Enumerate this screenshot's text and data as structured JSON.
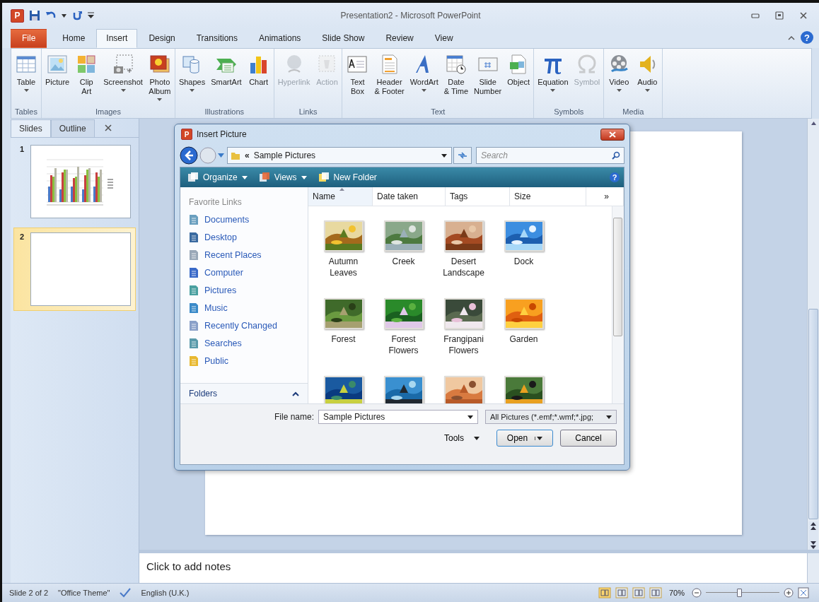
{
  "window": {
    "app_icon": "P",
    "title": "Presentation2 - Microsoft PowerPoint",
    "help": "?"
  },
  "tabs": [
    {
      "label": "File",
      "kind": "backstage",
      "selected": false
    },
    {
      "label": "Home",
      "kind": "tab",
      "selected": false
    },
    {
      "label": "Insert",
      "kind": "tab",
      "selected": true
    },
    {
      "label": "Design",
      "kind": "tab",
      "selected": false
    },
    {
      "label": "Transitions",
      "kind": "tab",
      "selected": false
    },
    {
      "label": "Animations",
      "kind": "tab",
      "selected": false
    },
    {
      "label": "Slide Show",
      "kind": "tab",
      "selected": false
    },
    {
      "label": "Review",
      "kind": "tab",
      "selected": false
    },
    {
      "label": "View",
      "kind": "tab",
      "selected": false
    }
  ],
  "ribbon": [
    {
      "label": "Tables",
      "buttons": [
        {
          "label": "Table",
          "dropdown": true,
          "disabled": false
        }
      ]
    },
    {
      "label": "Images",
      "buttons": [
        {
          "label": "Picture",
          "dropdown": false,
          "disabled": false
        },
        {
          "label": "Clip\nArt",
          "dropdown": false,
          "disabled": false
        },
        {
          "label": "Screenshot",
          "dropdown": true,
          "disabled": false
        },
        {
          "label": "Photo\nAlbum",
          "dropdown": true,
          "disabled": false
        }
      ]
    },
    {
      "label": "Illustrations",
      "buttons": [
        {
          "label": "Shapes",
          "dropdown": true,
          "disabled": false
        },
        {
          "label": "SmartArt",
          "dropdown": false,
          "disabled": false
        },
        {
          "label": "Chart",
          "dropdown": false,
          "disabled": false
        }
      ]
    },
    {
      "label": "Links",
      "buttons": [
        {
          "label": "Hyperlink",
          "dropdown": false,
          "disabled": true
        },
        {
          "label": "Action",
          "dropdown": false,
          "disabled": true
        }
      ]
    },
    {
      "label": "Text",
      "buttons": [
        {
          "label": "Text\nBox",
          "dropdown": false,
          "disabled": false
        },
        {
          "label": "Header\n& Footer",
          "dropdown": false,
          "disabled": false
        },
        {
          "label": "WordArt",
          "dropdown": true,
          "disabled": false
        },
        {
          "label": "Date\n& Time",
          "dropdown": false,
          "disabled": false
        },
        {
          "label": "Slide\nNumber",
          "dropdown": false,
          "disabled": false
        },
        {
          "label": "Object",
          "dropdown": false,
          "disabled": false
        }
      ]
    },
    {
      "label": "Symbols",
      "buttons": [
        {
          "label": "Equation",
          "dropdown": true,
          "disabled": false
        },
        {
          "label": "Symbol",
          "dropdown": false,
          "disabled": true
        }
      ]
    },
    {
      "label": "Media",
      "buttons": [
        {
          "label": "Video",
          "dropdown": true,
          "disabled": false
        },
        {
          "label": "Audio",
          "dropdown": true,
          "disabled": false
        }
      ]
    }
  ],
  "panel": {
    "tabs": [
      {
        "label": "Slides",
        "selected": true
      },
      {
        "label": "Outline",
        "selected": false
      }
    ],
    "slides": [
      {
        "number": "1",
        "selected": false,
        "kind": "chart"
      },
      {
        "number": "2",
        "selected": true,
        "kind": "blank"
      }
    ]
  },
  "notes": {
    "placeholder": "Click to add notes"
  },
  "dialog": {
    "icon": "P",
    "title": "Insert Picture",
    "address": {
      "prefix": "«",
      "folder": "Sample Pictures"
    },
    "search": {
      "placeholder": "Search"
    },
    "toolbar": [
      {
        "label": "Organize",
        "dropdown": true
      },
      {
        "label": "Views",
        "dropdown": true
      },
      {
        "label": "New Folder",
        "dropdown": false
      }
    ],
    "help": "?",
    "favorites_title": "Favorite Links",
    "links": [
      "Documents",
      "Desktop",
      "Recent Places",
      "Computer",
      "Pictures",
      "Music",
      "Recently Changed",
      "Searches",
      "Public"
    ],
    "folders": "Folders",
    "columns": [
      "Name",
      "Date taken",
      "Tags",
      "Size"
    ],
    "more_columns": "»",
    "files": [
      {
        "name": "Autumn Leaves",
        "kind": "picture"
      },
      {
        "name": "Creek",
        "kind": "picture"
      },
      {
        "name": "Desert Landscape",
        "kind": "picture"
      },
      {
        "name": "Dock",
        "kind": "picture"
      },
      {
        "name": "Forest",
        "kind": "picture"
      },
      {
        "name": "Forest Flowers",
        "kind": "picture"
      },
      {
        "name": "Frangipani Flowers",
        "kind": "picture"
      },
      {
        "name": "Garden",
        "kind": "picture"
      },
      {
        "kind": "picture"
      },
      {
        "kind": "picture"
      },
      {
        "kind": "picture"
      },
      {
        "kind": "picture"
      }
    ],
    "file_name_label": "File name:",
    "file_name": "Sample Pictures",
    "filter": "All Pictures (*.emf;*.wmf;*.jpg;",
    "tools": "Tools",
    "buttons": [
      {
        "label": "Open",
        "kind": "split"
      },
      {
        "label": "Cancel",
        "kind": "plain"
      }
    ]
  },
  "status_bar": {
    "slide": "Slide 2 of 2",
    "theme": "\"Office Theme\"",
    "language": "English (U.K.)",
    "views": [
      {
        "selected": true
      },
      {
        "selected": false
      },
      {
        "selected": false
      },
      {
        "selected": false
      }
    ],
    "zoom": "70%",
    "zoom_slider": {
      "level": 0.45
    }
  }
}
